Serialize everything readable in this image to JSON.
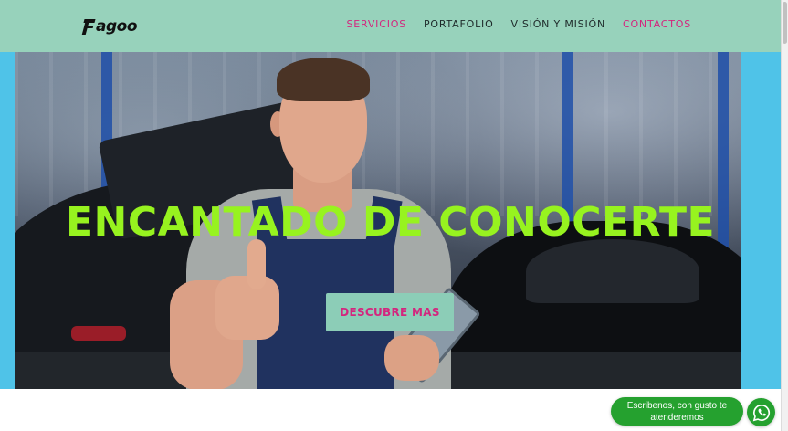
{
  "brand": {
    "name": "agoo",
    "logo_icon": "f-letter-logo-icon"
  },
  "nav": {
    "items": [
      {
        "label": "SERVICIOS",
        "color": "#d3267e"
      },
      {
        "label": "PORTAFOLIO",
        "color": "#1e2a2a"
      },
      {
        "label": "VISIÓN Y MISIÓN",
        "color": "#1e2a2a"
      },
      {
        "label": "CONTACTOS",
        "color": "#d3267e"
      }
    ]
  },
  "hero": {
    "title": "ENCANTADO DE CONOCERTE",
    "cta_label": "DESCUBRE MAS",
    "image": "mechanic-thumbs-up-photo"
  },
  "whatsapp": {
    "line1": "Escribenos, con gusto te",
    "line2": "atenderemos",
    "icon": "whatsapp-icon"
  },
  "colors": {
    "nav_bg": "#97d2bb",
    "accent_pink": "#d3267e",
    "title_green": "#97f31f",
    "cta_bg": "#8ccdb7",
    "hero_side": "#4fc3e8",
    "whatsapp_green": "#25a12f"
  }
}
